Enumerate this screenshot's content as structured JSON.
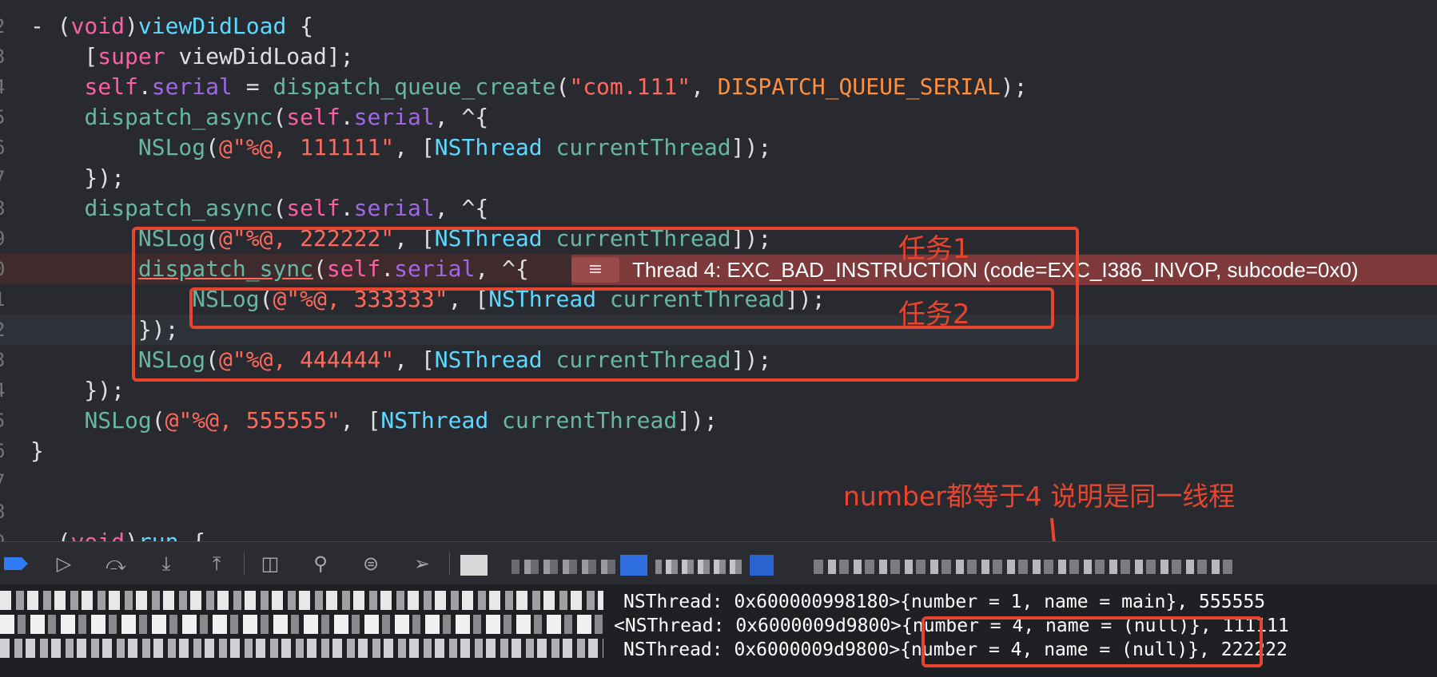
{
  "code_lines": [
    {
      "num": "2",
      "segments": [
        [
          "- (",
          ""
        ],
        [
          "void",
          "kw"
        ],
        [
          ")",
          ""
        ],
        [
          "viewDidLoad",
          "ty"
        ],
        [
          " {",
          ""
        ]
      ]
    },
    {
      "num": "3",
      "segments": [
        [
          "    [",
          ""
        ],
        [
          "super",
          "kw"
        ],
        [
          " viewDidLoad];",
          ""
        ]
      ]
    },
    {
      "num": "4",
      "segments": [
        [
          "    ",
          ""
        ],
        [
          "self",
          "kw"
        ],
        [
          ".",
          ""
        ],
        [
          "serial",
          "cls"
        ],
        [
          " = ",
          ""
        ],
        [
          "dispatch_queue_create",
          "fn"
        ],
        [
          "(",
          ""
        ],
        [
          "\"com.111\"",
          "str"
        ],
        [
          ", ",
          ""
        ],
        [
          "DISPATCH_QUEUE_SERIAL",
          "mac"
        ],
        [
          ");",
          ""
        ]
      ]
    },
    {
      "num": "5",
      "segments": [
        [
          "    ",
          ""
        ],
        [
          "dispatch_async",
          "fn"
        ],
        [
          "(",
          ""
        ],
        [
          "self",
          "kw"
        ],
        [
          ".",
          ""
        ],
        [
          "serial",
          "cls"
        ],
        [
          ", ^{",
          ""
        ]
      ]
    },
    {
      "num": "6",
      "segments": [
        [
          "        ",
          ""
        ],
        [
          "NSLog",
          "fn"
        ],
        [
          "(",
          ""
        ],
        [
          "@\"%@, 111111\"",
          "str"
        ],
        [
          ", [",
          ""
        ],
        [
          "NSThread",
          "ty"
        ],
        [
          " ",
          ""
        ],
        [
          "currentThread",
          "fn"
        ],
        [
          "]);",
          ""
        ]
      ]
    },
    {
      "num": "7",
      "segments": [
        [
          "    });",
          ""
        ]
      ]
    },
    {
      "num": "8",
      "segments": [
        [
          "    ",
          ""
        ],
        [
          "dispatch_async",
          "fn"
        ],
        [
          "(",
          ""
        ],
        [
          "self",
          "kw"
        ],
        [
          ".",
          ""
        ],
        [
          "serial",
          "cls"
        ],
        [
          ", ^{",
          ""
        ]
      ]
    },
    {
      "num": "9",
      "segments": [
        [
          "        ",
          ""
        ],
        [
          "NSLog",
          "fn"
        ],
        [
          "(",
          ""
        ],
        [
          "@\"%@, 222222\"",
          "str"
        ],
        [
          ", [",
          ""
        ],
        [
          "NSThread",
          "ty"
        ],
        [
          " ",
          ""
        ],
        [
          "currentThread",
          "fn"
        ],
        [
          "]);",
          ""
        ]
      ]
    },
    {
      "num": "0",
      "error": true,
      "segments": [
        [
          "        ",
          ""
        ],
        [
          "dispatch_sync",
          "fn un"
        ],
        [
          "(",
          ""
        ],
        [
          "self",
          "kw"
        ],
        [
          ".",
          ""
        ],
        [
          "serial",
          "cls"
        ],
        [
          ", ^{",
          ""
        ]
      ]
    },
    {
      "num": "1",
      "segments": [
        [
          "            ",
          ""
        ],
        [
          "NSLog",
          "fn"
        ],
        [
          "(",
          ""
        ],
        [
          "@\"%@, 333333\"",
          "str"
        ],
        [
          ", [",
          ""
        ],
        [
          "NSThread",
          "ty"
        ],
        [
          " ",
          ""
        ],
        [
          "currentThread",
          "fn"
        ],
        [
          "]);",
          ""
        ]
      ]
    },
    {
      "num": "2",
      "current": true,
      "segments": [
        [
          "        });",
          ""
        ]
      ]
    },
    {
      "num": "3",
      "segments": [
        [
          "        ",
          ""
        ],
        [
          "NSLog",
          "fn"
        ],
        [
          "(",
          ""
        ],
        [
          "@\"%@, 444444\"",
          "str"
        ],
        [
          ", [",
          ""
        ],
        [
          "NSThread",
          "ty"
        ],
        [
          " ",
          ""
        ],
        [
          "currentThread",
          "fn"
        ],
        [
          "]);",
          ""
        ]
      ]
    },
    {
      "num": "4",
      "segments": [
        [
          "    });",
          ""
        ]
      ]
    },
    {
      "num": "5",
      "segments": [
        [
          "    ",
          ""
        ],
        [
          "NSLog",
          "fn"
        ],
        [
          "(",
          ""
        ],
        [
          "@\"%@, 555555\"",
          "str"
        ],
        [
          ", [",
          ""
        ],
        [
          "NSThread",
          "ty"
        ],
        [
          " ",
          ""
        ],
        [
          "currentThread",
          "fn"
        ],
        [
          "]);",
          ""
        ]
      ]
    },
    {
      "num": "6",
      "segments": [
        [
          "}",
          ""
        ]
      ]
    },
    {
      "num": "7",
      "segments": []
    },
    {
      "num": "8",
      "segments": []
    },
    {
      "num": "9",
      "segments": [
        [
          "  (",
          ""
        ],
        [
          "void",
          "kw"
        ],
        [
          ")",
          ""
        ],
        [
          "run",
          "ty"
        ],
        [
          " {",
          ""
        ]
      ]
    }
  ],
  "error_bar": {
    "icon": "lines-icon",
    "message": "Thread 4: EXC_BAD_INSTRUCTION (code=EXC_I386_INVOP, subcode=0x0)"
  },
  "annotations": {
    "task1": "任务1",
    "task2": "任务2",
    "note": "number都等于4 说明是同一线程",
    "accent": "#e8452e"
  },
  "toolbar": {
    "icons": [
      "breakpoint-toggle-icon",
      "continue-icon",
      "step-over-icon",
      "step-into-icon",
      "step-out-icon",
      "debug-view-hierarchy-icon",
      "memory-graph-icon",
      "environment-overrides-icon",
      "simulate-location-icon"
    ]
  },
  "console": {
    "lines": [
      "NSThread: 0x600000998180>{number = 1, name = main}, 555555",
      "<NSThread: 0x6000009d9800>{number = 4, name = (null)}, 111111",
      "NSThread: 0x6000009d9800>{number = 4, name = (null)}, 222222"
    ]
  }
}
